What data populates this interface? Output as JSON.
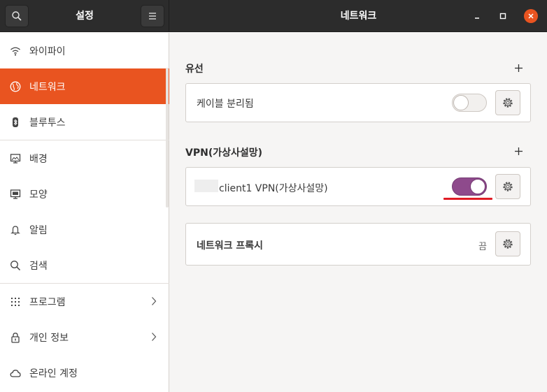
{
  "header": {
    "settings_title": "설정",
    "page_title": "네트워크"
  },
  "sidebar": {
    "items": [
      {
        "label": "와이파이",
        "icon": "wifi-icon"
      },
      {
        "label": "네트워크",
        "icon": "globe-icon",
        "active": true
      },
      {
        "label": "블루투스",
        "icon": "bluetooth-icon"
      },
      {
        "label": "배경",
        "icon": "background-icon"
      },
      {
        "label": "모양",
        "icon": "appearance-icon"
      },
      {
        "label": "알림",
        "icon": "bell-icon"
      },
      {
        "label": "검색",
        "icon": "search-icon"
      },
      {
        "label": "프로그램",
        "icon": "apps-grid-icon",
        "has_chevron": true
      },
      {
        "label": "개인 정보",
        "icon": "lock-icon",
        "has_chevron": true
      },
      {
        "label": "온라인 계정",
        "icon": "cloud-icon"
      }
    ]
  },
  "wired": {
    "title": "유선",
    "connection_label": "케이블 분리됨",
    "enabled": false
  },
  "vpn": {
    "title": "VPN(가상사설망)",
    "connection_label": "client1 VPN(가상사설망)",
    "enabled": true
  },
  "proxy": {
    "label": "네트워크 프록시",
    "status": "끔"
  },
  "colors": {
    "accent": "#e95420",
    "toggle_on": "#8e4a8c",
    "annotation": "#e01b24"
  }
}
